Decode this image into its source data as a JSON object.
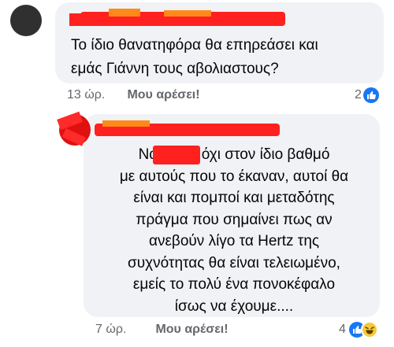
{
  "colors": {
    "bubble": "#f0f2f5",
    "meta_text": "#65676b",
    "like_blue": "#1877f2",
    "haha_yellow": "#f7c935",
    "redaction": "#ff2020"
  },
  "comments": [
    {
      "text_lines": [
        "Το ίδιο θανατηφόρα θα επηρεάσει και",
        "εμάς Γιάννη τους αβολιαστους?"
      ],
      "time": "13 ώρ.",
      "like_label": "Μου αρέσει!",
      "reactions": {
        "icon": "like-icon",
        "count": "2"
      }
    },
    {
      "text_lines": [
        "Ναι        αλλά όχι στον ίδιο βαθμό",
        "με αυτούς που το έκαναν, αυτοί θα",
        "είναι και πομποί και μεταδότης",
        "πράγμα που σημαίνει πως αν",
        "ανεβούν λίγο τα Hertz της",
        "συχνότητας θα είναι τελειωμένο,",
        "εμείς το πολύ ένα πονοκέφαλο",
        "ίσως να έχουμε...."
      ],
      "time": "7 ώρ.",
      "like_label": "Μου αρέσει!",
      "reactions": {
        "icons": [
          "like-icon",
          "haha-icon"
        ],
        "count": "4"
      }
    }
  ]
}
